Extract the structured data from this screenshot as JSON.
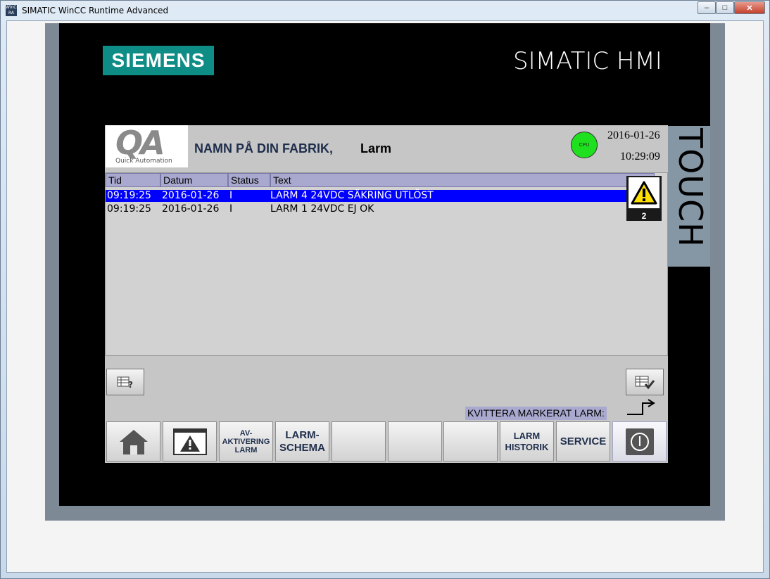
{
  "window": {
    "title": "SIMATIC WinCC Runtime Advanced",
    "icon_text": "WinCC RA",
    "controls": {
      "minimize": "–",
      "maximize": "□",
      "close": "✕"
    }
  },
  "panel": {
    "brand": "SIEMENS",
    "model": "SIMATIC HMI",
    "side_label": "TOUCH"
  },
  "header": {
    "logo_letters": "QA",
    "logo_sub": "Quick Automation",
    "factory_name": "NAMN PÅ DIN FABRIK,",
    "screen_title": "Larm",
    "cpu_label": "CPU",
    "date": "2016-01-26",
    "time": "10:29:09"
  },
  "alarm_table": {
    "columns": [
      "Tid",
      "Datum",
      "Status",
      "Text"
    ],
    "rows": [
      {
        "time": "09:19:25",
        "date": "2016-01-26",
        "status": "I",
        "text": "LARM 4 24VDC SÄKRING UTLÖST",
        "selected": true
      },
      {
        "time": "09:19:25",
        "date": "2016-01-26",
        "status": "I",
        "text": "LARM 1 24VDC EJ OK",
        "selected": false
      }
    ]
  },
  "alarm_indicator": {
    "count": "2",
    "icon": "warning-icon"
  },
  "acknowledge": {
    "label": "KVITTERA MARKERAT LARM:"
  },
  "buttons": {
    "home": "home-icon",
    "alarms": "alarm-window-icon",
    "deactivate_line1": "AV-",
    "deactivate_line2": "AKTIVERING",
    "deactivate_line3": "LARM",
    "schema_line1": "LARM-",
    "schema_line2": "SCHEMA",
    "history_line1": "LARM",
    "history_line2": "HISTORIK",
    "service": "SERVICE",
    "power": "power-icon"
  },
  "colors": {
    "selected_row": "#0000ff",
    "header_cols": "#a9a9cf",
    "brand_teal": "#0e8c86",
    "cpu_ok": "#1ee01e"
  }
}
